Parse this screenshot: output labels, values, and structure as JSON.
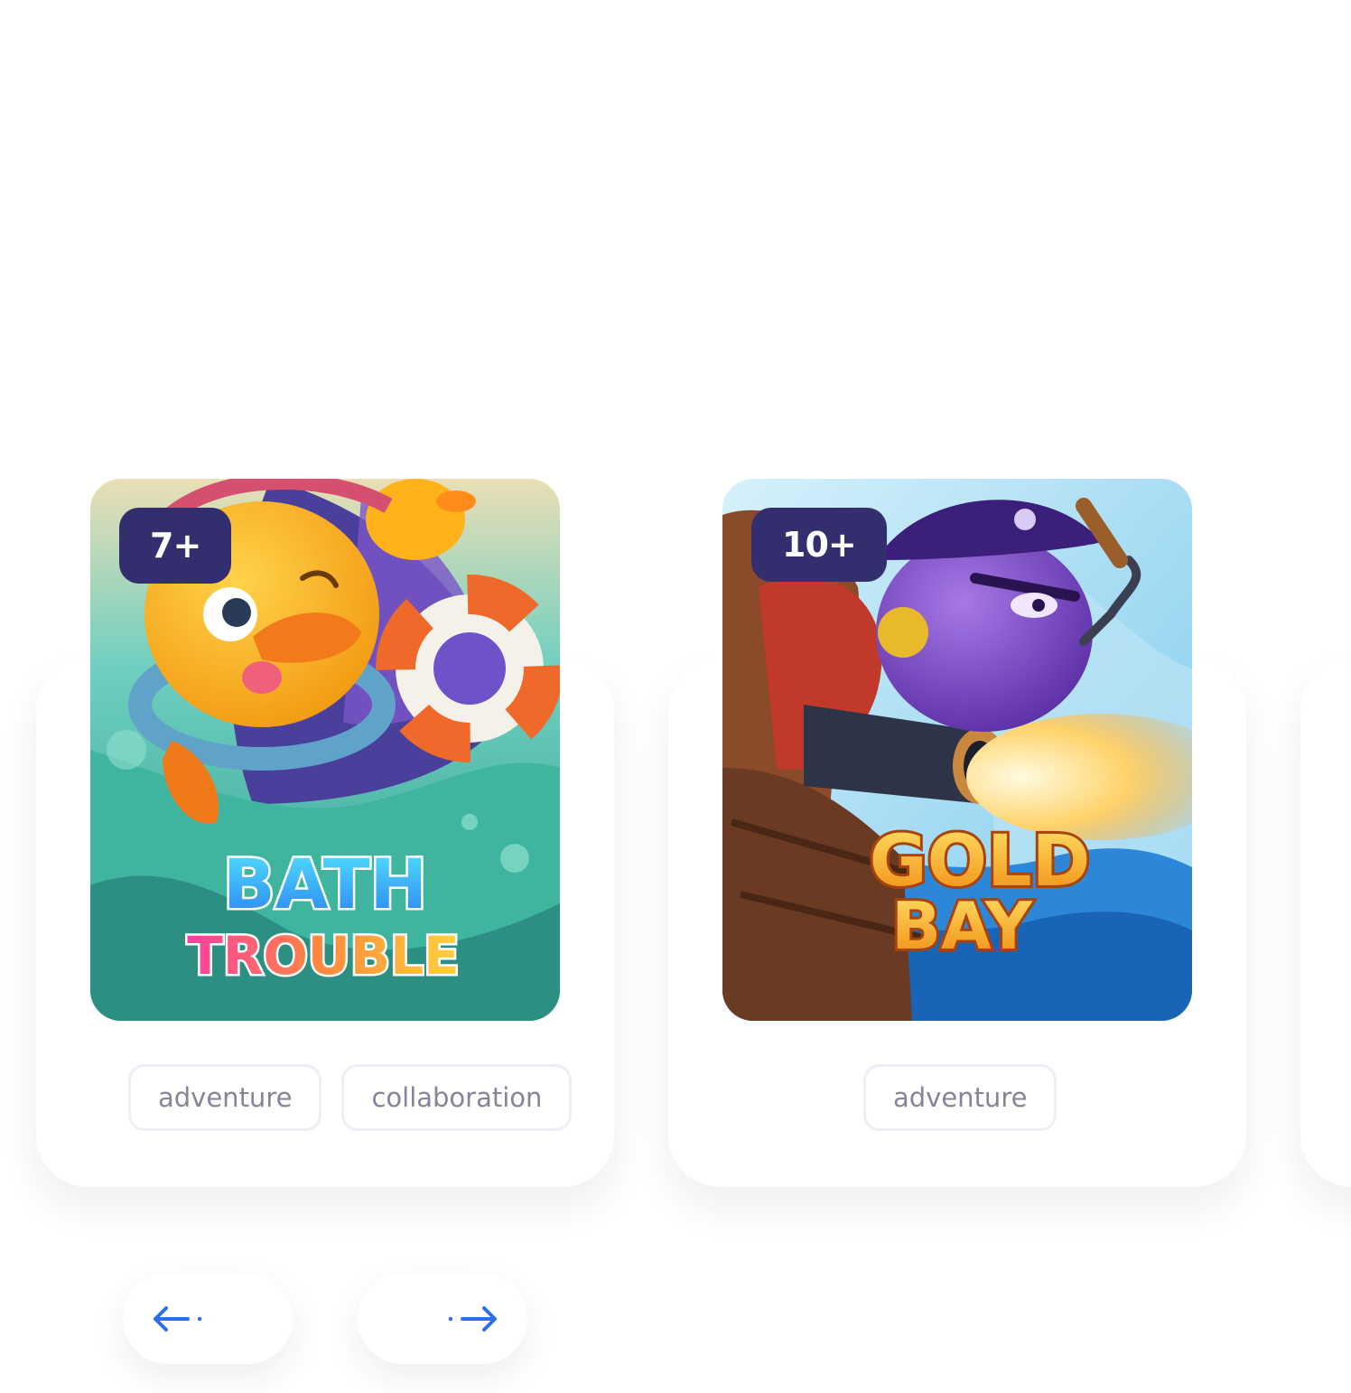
{
  "games": [
    {
      "age_label": "7+",
      "logo_line1": "BATH",
      "logo_line2": "TROUBLE",
      "tags": [
        "adventure",
        "collaboration"
      ]
    },
    {
      "age_label": "10+",
      "logo_line1": "GOLD",
      "logo_line2": "BAY",
      "tags": [
        "adventure"
      ]
    }
  ],
  "navigation": {
    "prev_icon": "arrow-left-icon",
    "next_icon": "arrow-right-icon"
  },
  "colors": {
    "badge_bg": "#332f6f",
    "arrow": "#2f6ee8",
    "tag_text": "#85849a",
    "tag_border": "#eeeef6"
  }
}
